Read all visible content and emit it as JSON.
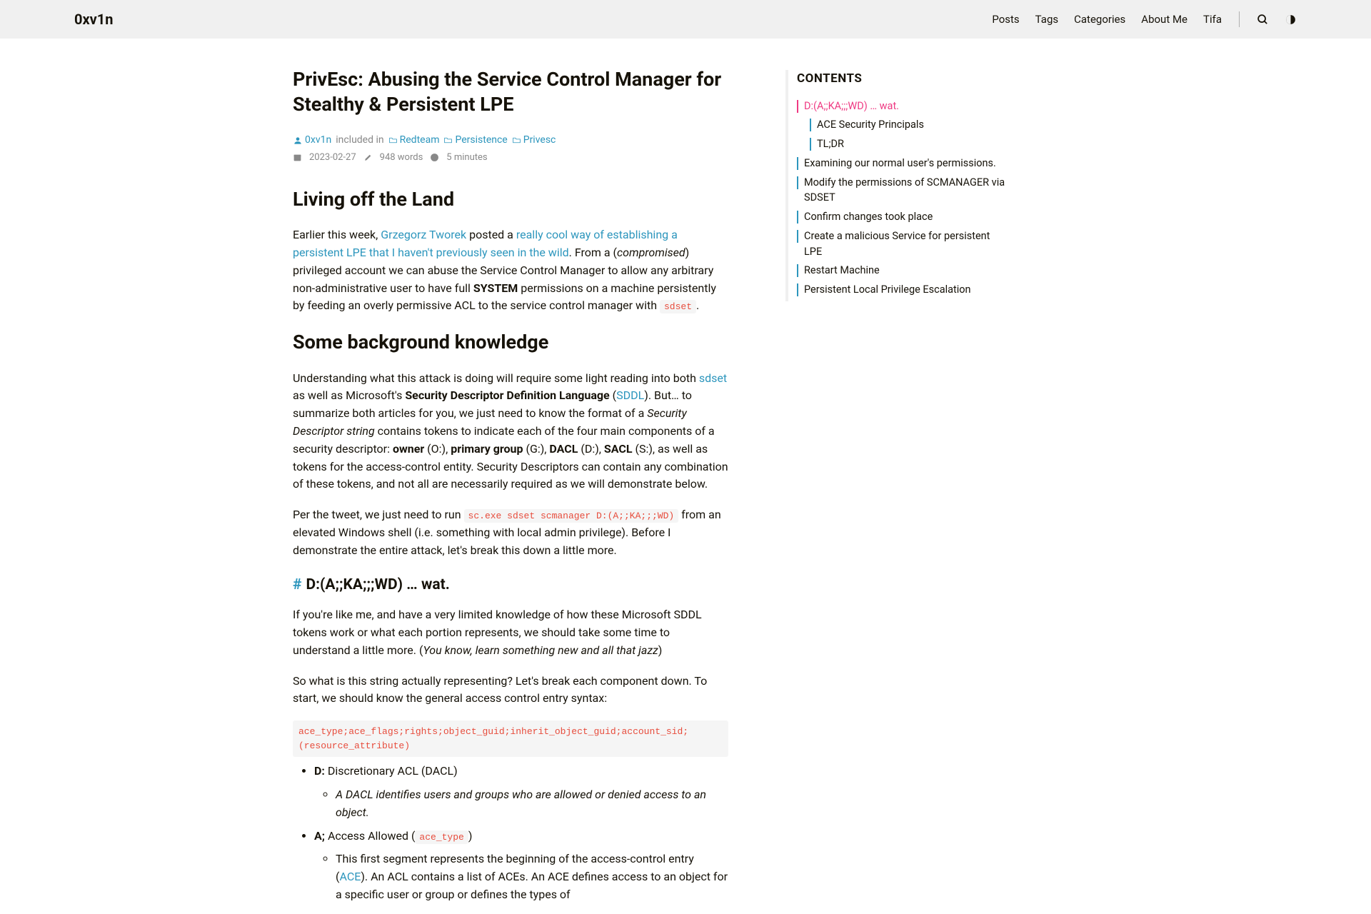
{
  "header": {
    "site_title": "0xv1n",
    "nav": [
      "Posts",
      "Tags",
      "Categories",
      "About Me",
      "Tifa"
    ]
  },
  "post": {
    "title": "PrivEsc: Abusing the Service Control Manager for Stealthy & Persistent LPE",
    "author": "0xv1n",
    "included_label": "included in",
    "categories": [
      "Redteam",
      "Persistence",
      "Privesc"
    ],
    "date": "2023-02-27",
    "words": "948 words",
    "readtime": "5 minutes"
  },
  "sections": {
    "living_title": "Living off the Land",
    "p1_a": "Earlier this week, ",
    "p1_link1": "Grzegorz Tworek",
    "p1_b": " posted a ",
    "p1_link2": "really cool way of establishing a persistent LPE that I haven't previously seen in the wild",
    "p1_c": ". From a (",
    "p1_em": "compromised",
    "p1_d": ") privileged account we can abuse the Service Control Manager to allow any arbitrary non-administrative user to have full ",
    "p1_strong": "SYSTEM",
    "p1_e": " permissions on a machine persistently by feeding an overly permissive ACL to the service control manager with ",
    "p1_code": "sdset",
    "p1_f": ".",
    "bg_title": "Some background knowledge",
    "p2_a": "Understanding what this attack is doing will require some light reading into both ",
    "p2_link1": "sdset",
    "p2_b": " as well as Microsoft's ",
    "p2_strong1": "Security Descriptor Definition Language",
    "p2_c": " (",
    "p2_link2": "SDDL",
    "p2_d": "). But… to summarize both articles for you, we just need to know the format of a ",
    "p2_em1": "Security Descriptor string",
    "p2_e": " contains tokens to indicate each of the four main components of a security descriptor: ",
    "p2_strong2": "owner",
    "p2_f": " (O:), ",
    "p2_strong3": "primary group",
    "p2_g": " (G:), ",
    "p2_strong4": "DACL",
    "p2_h": " (D:), ",
    "p2_strong5": "SACL",
    "p2_i": " (S:), as well as tokens for the access-control entity. Security Descriptors can contain any combination of these tokens, and not all are necessarily required as we will demonstrate below.",
    "p3_a": "Per the tweet, we just need to run ",
    "p3_code": "sc.exe sdset scmanager D:(A;;KA;;;WD)",
    "p3_b": " from an elevated Windows shell (i.e. something with local admin privilege). Before I demonstrate the entire attack, let's break this down a little more.",
    "wat_title": "D:(A;;KA;;;WD) … wat.",
    "p4_a": "If you're like me, and have a very limited knowledge of how these Microsoft SDDL tokens work or what each portion represents, we should take some time to understand a little more. (",
    "p4_em": "You know, learn something new and all that jazz",
    "p4_b": ")",
    "p5": "So what is this string actually representing? Let's break each component down. To start, we should know the general access control entry syntax:",
    "syntax_code": "ace_type;ace_flags;rights;object_guid;inherit_object_guid;account_sid;(resource_attribute)",
    "li1_strong": "D:",
    "li1_text": " Discretionary ACL (DACL)",
    "li1_sub_em": "A DACL identifies users and groups who are allowed or denied access to an object.",
    "li2_strong": "A;",
    "li2_text": " Access Allowed (",
    "li2_code": "ace_type",
    "li2_text2": ")",
    "li2_sub_a": "This first segment represents the beginning of the access-control entry (",
    "li2_sub_link": "ACE",
    "li2_sub_b": "). An ACL contains a list of ACEs. An ACE defines access to an object for a specific user or group or defines the types of"
  },
  "toc": {
    "title": "CONTENTS",
    "items": [
      {
        "label": "D:(A;;KA;;;WD) … wat.",
        "level": 1,
        "active": true
      },
      {
        "label": "ACE Security Principals",
        "level": 2,
        "active": false
      },
      {
        "label": "TL;DR",
        "level": 2,
        "active": false
      },
      {
        "label": "Examining our normal user's permissions.",
        "level": 1,
        "active": false
      },
      {
        "label": "Modify the permissions of SCMANAGER via SDSET",
        "level": 1,
        "active": false
      },
      {
        "label": "Confirm changes took place",
        "level": 1,
        "active": false
      },
      {
        "label": "Create a malicious Service for persistent LPE",
        "level": 1,
        "active": false
      },
      {
        "label": "Restart Machine",
        "level": 1,
        "active": false
      },
      {
        "label": "Persistent Local Privilege Escalation",
        "level": 1,
        "active": false
      }
    ]
  }
}
